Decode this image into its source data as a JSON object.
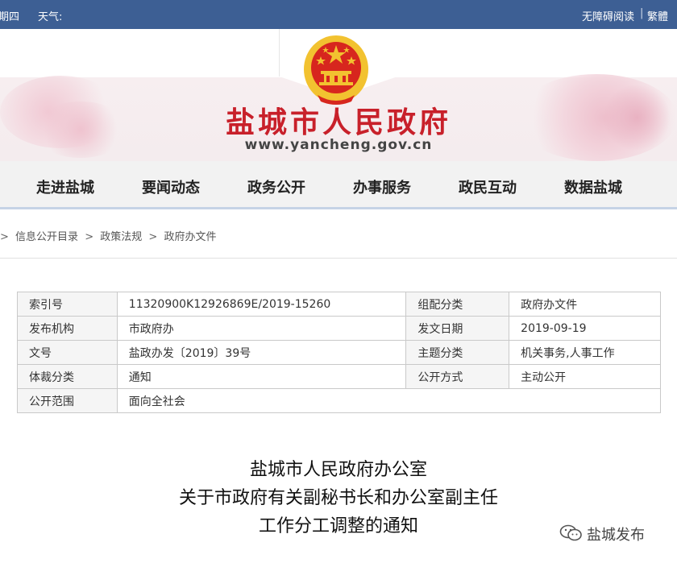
{
  "topbar": {
    "day": "期四",
    "weather": "天气:",
    "accessibility": "无障碍阅读",
    "separator": "|",
    "traditional": "繁體"
  },
  "header": {
    "site_title": "盐城市人民政府",
    "site_url": "www.yancheng.gov.cn"
  },
  "nav": {
    "items": [
      "走进盐城",
      "要闻动态",
      "政务公开",
      "办事服务",
      "政民互动",
      "数据盐城"
    ]
  },
  "breadcrumb": {
    "sep": ">",
    "items": [
      "信息公开目录",
      "政策法规",
      "政府办文件"
    ]
  },
  "meta": {
    "index_no_label": "索引号",
    "index_no_value": "11320900K12926869E/2019-15260",
    "category_label": "组配分类",
    "category_value": "政府办文件",
    "publisher_label": "发布机构",
    "publisher_value": "市政府办",
    "date_label": "发文日期",
    "date_value": "2019-09-19",
    "doc_no_label": "文号",
    "doc_no_value": "盐政办发〔2019〕39号",
    "topic_label": "主题分类",
    "topic_value": "机关事务,人事工作",
    "genre_label": "体裁分类",
    "genre_value": "通知",
    "open_mode_label": "公开方式",
    "open_mode_value": "主动公开",
    "scope_label": "公开范围",
    "scope_value": "面向全社会"
  },
  "doc": {
    "title_line1": "盐城市人民政府办公室",
    "title_line2": "关于市政府有关副秘书长和办公室副主任",
    "title_line3": "工作分工调整的通知"
  },
  "watermark": {
    "text": "盐城发布",
    "icon": "wechat-icon"
  },
  "colors": {
    "topbar": "#3d5f94",
    "title_red": "#c8202a",
    "emblem_red": "#d7261e",
    "emblem_gold": "#f2c230"
  }
}
